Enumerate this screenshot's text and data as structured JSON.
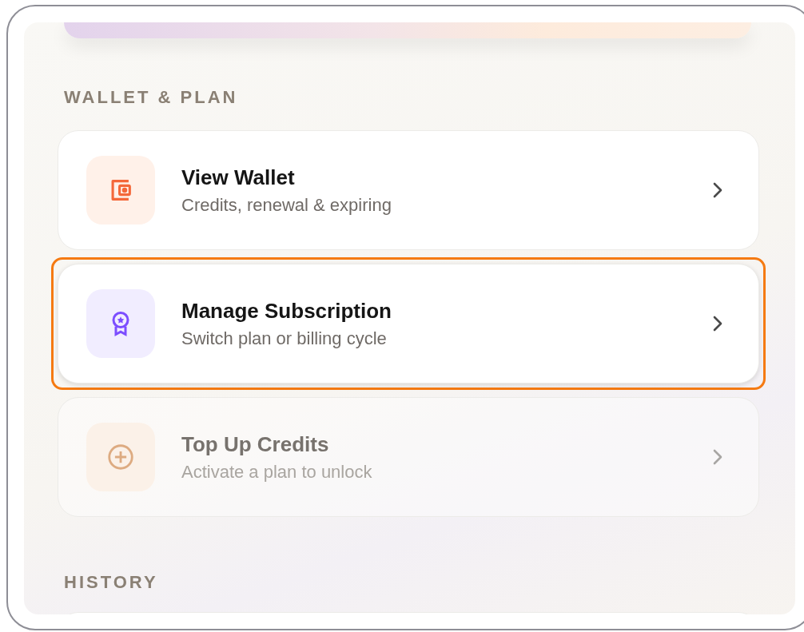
{
  "sections": [
    {
      "title": "WALLET & PLAN",
      "items": [
        {
          "kind": "wallet",
          "title": "View Wallet",
          "subtitle": "Credits, renewal & expiring",
          "highlighted": false,
          "disabled": false
        },
        {
          "kind": "award",
          "title": "Manage Subscription",
          "subtitle": "Switch plan or billing cycle",
          "highlighted": true,
          "disabled": false
        },
        {
          "kind": "plus",
          "title": "Top Up Credits",
          "subtitle": "Activate a plan to unlock",
          "highlighted": false,
          "disabled": true
        }
      ]
    },
    {
      "title": "HISTORY"
    }
  ]
}
